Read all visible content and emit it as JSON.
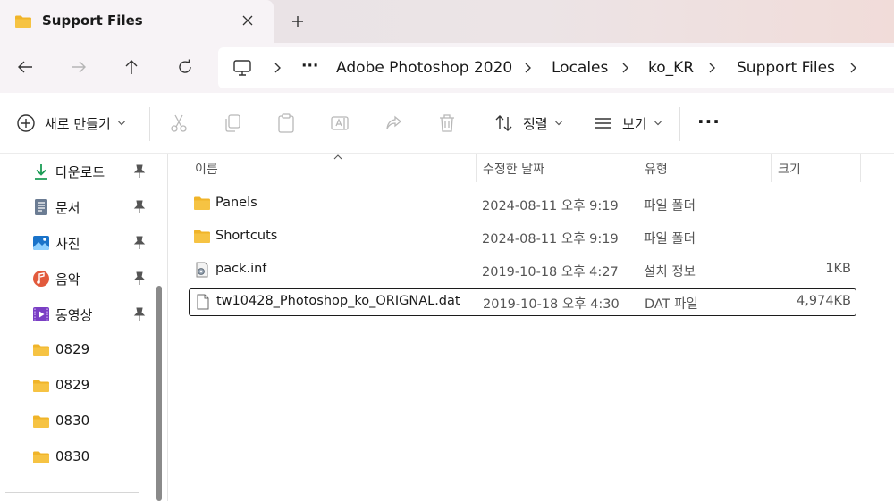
{
  "window": {
    "tab_title": "Support Files",
    "new_tab_symbol": "+"
  },
  "breadcrumb": {
    "more": "···",
    "items": [
      "Adobe Photoshop 2020",
      "Locales",
      "ko_KR",
      "Support Files"
    ]
  },
  "toolbar": {
    "new_label": "새로 만들기",
    "sort_label": "정렬",
    "view_label": "보기",
    "more": "···"
  },
  "sidebar": {
    "items": [
      {
        "label": "다운로드",
        "icon": "download-icon",
        "pinned": true
      },
      {
        "label": "문서",
        "icon": "document-icon",
        "pinned": true
      },
      {
        "label": "사진",
        "icon": "pictures-icon",
        "pinned": true
      },
      {
        "label": "음악",
        "icon": "music-icon",
        "pinned": true
      },
      {
        "label": "동영상",
        "icon": "video-icon",
        "pinned": true
      },
      {
        "label": "0829",
        "icon": "folder-icon",
        "pinned": false
      },
      {
        "label": "0829",
        "icon": "folder-icon",
        "pinned": false
      },
      {
        "label": "0830",
        "icon": "folder-icon",
        "pinned": false
      },
      {
        "label": "0830",
        "icon": "folder-icon",
        "pinned": false
      }
    ]
  },
  "table": {
    "columns": [
      "이름",
      "수정한 날짜",
      "유형",
      "크기"
    ],
    "rows": [
      {
        "name": "Panels",
        "date": "2024-08-11 오후 9:19",
        "type": "파일 폴더",
        "size": "",
        "icon": "folder-icon"
      },
      {
        "name": "Shortcuts",
        "date": "2024-08-11 오후 9:19",
        "type": "파일 폴더",
        "size": "",
        "icon": "folder-icon"
      },
      {
        "name": "pack.inf",
        "date": "2019-10-18 오후 4:27",
        "type": "설치 정보",
        "size": "1KB",
        "icon": "setup-info-icon"
      },
      {
        "name": "tw10428_Photoshop_ko_ORIGNAL.dat",
        "date": "2019-10-18 오후 4:30",
        "type": "DAT 파일",
        "size": "4,974KB",
        "icon": "file-icon"
      }
    ]
  },
  "colors": {
    "folder": "#f6c343",
    "accent": "#0067c0",
    "selection_border": "#1c1c1c"
  }
}
